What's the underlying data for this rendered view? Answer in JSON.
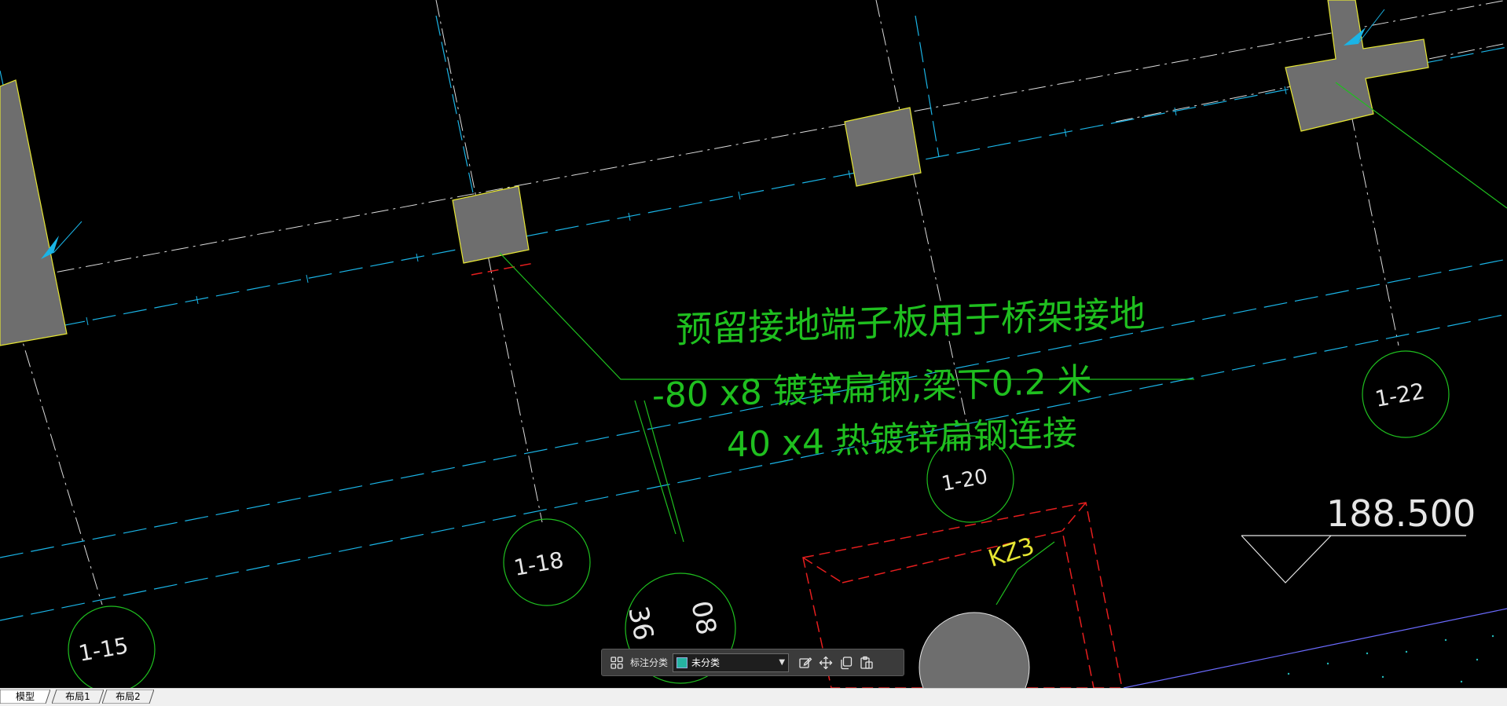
{
  "drawing": {
    "annotation_line1": "预留接地端子板用于桥架接地",
    "annotation_line2": "-80 x8 镀锌扁钢,梁下0.2 米",
    "annotation_line3": "40 x4 热镀锌扁钢连接",
    "elevation_value": "188.500",
    "column_tag": "KZ3",
    "grid_labels": {
      "g15": "1-15",
      "g18": "1-18",
      "g20": "1-20",
      "g22": "1-22",
      "g36": "36",
      "g08": "08"
    }
  },
  "annotation_toolbar": {
    "category_label": "标注分类",
    "category_value": "未分类",
    "icons": [
      "grid-icon",
      "edit-icon",
      "move-icon",
      "copy-icon",
      "paste-icon"
    ]
  },
  "tabs": [
    {
      "label": "模型",
      "active": true
    },
    {
      "label": "布局1",
      "active": false
    },
    {
      "label": "布局2",
      "active": false
    }
  ],
  "colors": {
    "background": "#000000",
    "annotation_green": "#1fbf1f",
    "axis_cyan": "#1ab4e6",
    "column_yellow": "#e6e633",
    "column_fill": "#6e6e6e",
    "dashed_red": "#e61e1e",
    "swatch": "#26b3a1"
  }
}
